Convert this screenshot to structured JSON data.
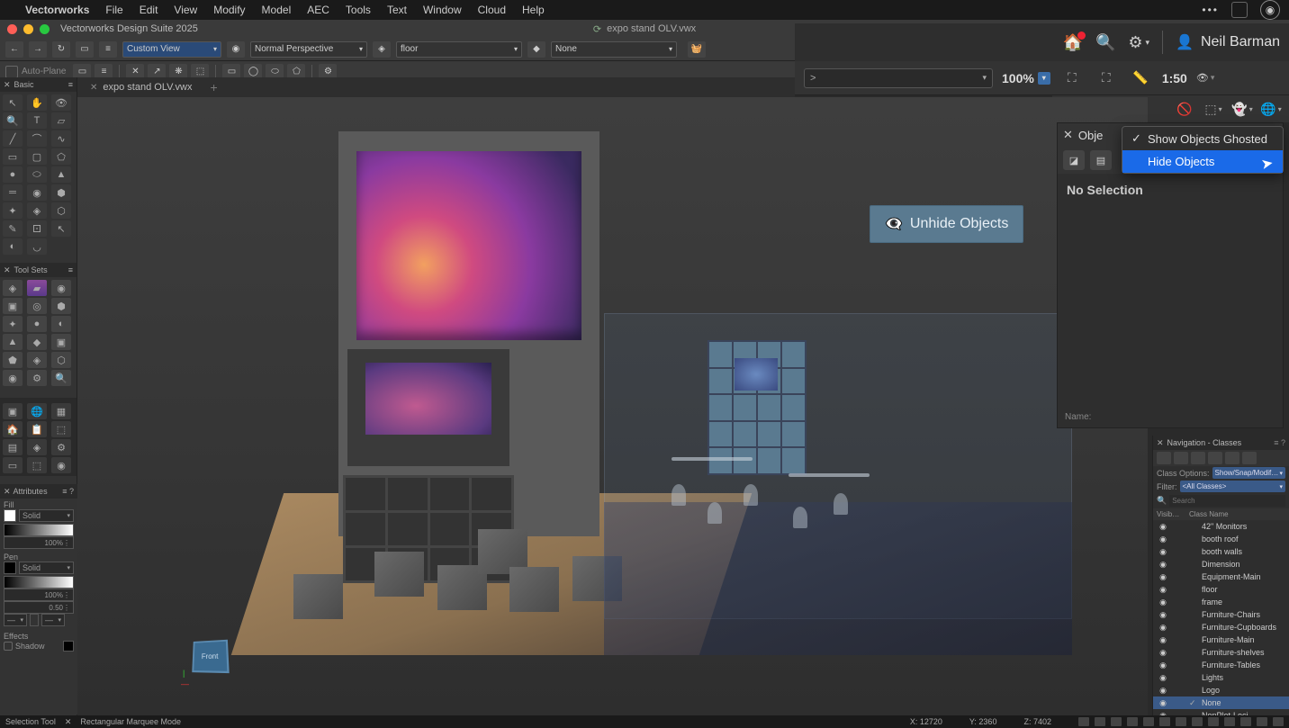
{
  "os": {
    "app": "Vectorworks",
    "menus": [
      "File",
      "Edit",
      "View",
      "Modify",
      "Model",
      "AEC",
      "Tools",
      "Text",
      "Window",
      "Cloud",
      "Help"
    ]
  },
  "window": {
    "title": "Vectorworks Design Suite 2025",
    "doc_title": "expo stand OLV.vwx"
  },
  "topbar": {
    "view_dd": "Custom View",
    "render_dd": "Normal Perspective",
    "layer_dd": "floor",
    "class_dd": "None"
  },
  "modebar": {
    "autoplane": "Auto-Plane"
  },
  "secbar": {
    "dropdown_value": ">",
    "zoom": "100%",
    "scale": "1:50"
  },
  "user": {
    "name": "Neil Barman"
  },
  "doc_tabs": {
    "tab1": "expo stand OLV.vwx"
  },
  "palette": {
    "basic": "Basic",
    "toolsets": "Tool Sets",
    "attributes": "Attributes",
    "fill": "Fill",
    "fill_mode": "Solid",
    "fill_opacity": "100%",
    "pen": "Pen",
    "pen_mode": "Solid",
    "pen_opacity": "100%",
    "pen_weight": "0.50",
    "effects": "Effects",
    "shadow": "Shadow"
  },
  "viewport": {
    "unhide_label": "Unhide Objects",
    "axis_face": "Front"
  },
  "obj_panel": {
    "title": "Obje",
    "no_selection": "No Selection",
    "name_label": "Name:"
  },
  "ghost_menu": {
    "item1": "Show Objects Ghosted",
    "item2": "Hide Objects"
  },
  "nav_panel": {
    "title": "Navigation - Classes",
    "class_options_label": "Class Options:",
    "class_options_value": "Show/Snap/Modif…",
    "filter_label": "Filter:",
    "filter_value": "<All Classes>",
    "search_placeholder": "Search",
    "col_vis": "Visib…",
    "col_class": "Class Name",
    "classes": [
      {
        "name": "42\" Monitors"
      },
      {
        "name": "booth roof"
      },
      {
        "name": "booth walls"
      },
      {
        "name": "Dimension"
      },
      {
        "name": "Equipment-Main"
      },
      {
        "name": "floor"
      },
      {
        "name": "frame"
      },
      {
        "name": "Furniture-Chairs"
      },
      {
        "name": "Furniture-Cupboards"
      },
      {
        "name": "Furniture-Main"
      },
      {
        "name": "Furniture-shelves"
      },
      {
        "name": "Furniture-Tables"
      },
      {
        "name": "Lights"
      },
      {
        "name": "Logo"
      },
      {
        "name": "None",
        "selected": true,
        "checked": true
      },
      {
        "name": "NonPlot-Loci"
      }
    ]
  },
  "statusbar": {
    "tool": "Selection Tool",
    "mode": "Rectangular Marquee Mode",
    "x_label": "X:",
    "x": "12720",
    "y_label": "Y:",
    "y": "2360",
    "z_label": "Z:",
    "z": "7402"
  }
}
